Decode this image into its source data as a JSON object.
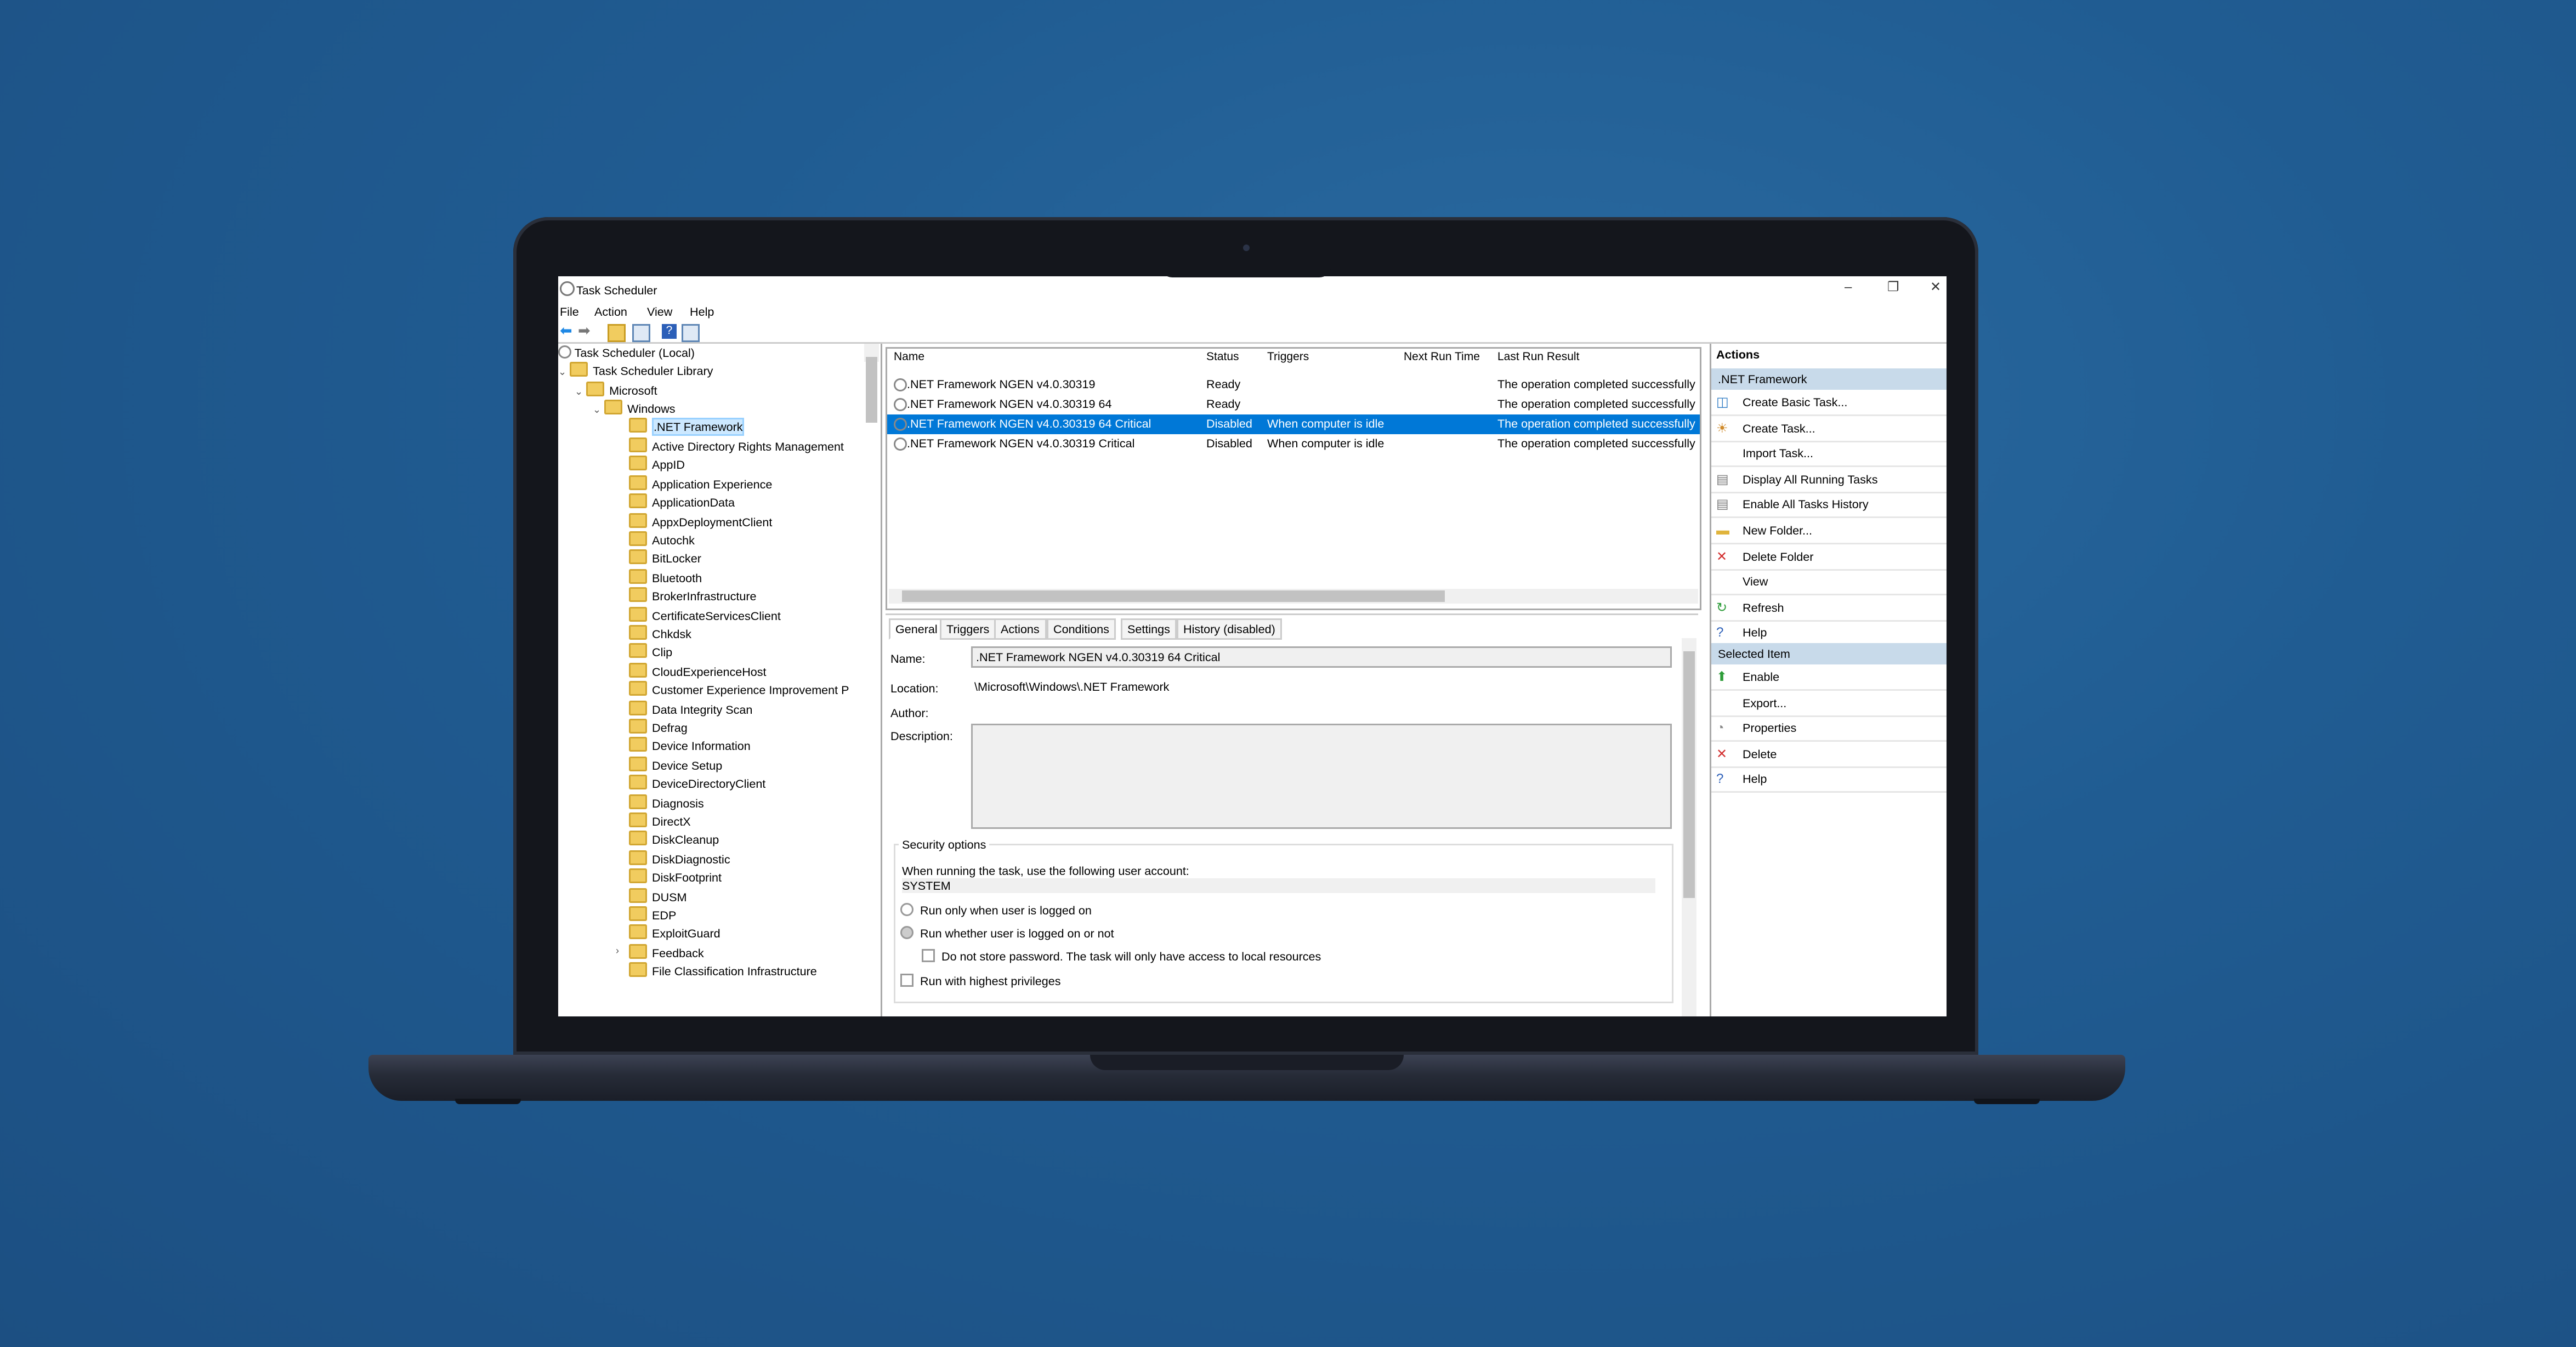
{
  "window": {
    "title": "Task Scheduler",
    "menu": [
      "File",
      "Action",
      "View",
      "Help"
    ]
  },
  "tree": {
    "root": "Task Scheduler (Local)",
    "library": "Task Scheduler Library",
    "microsoft": "Microsoft",
    "windows": "Windows",
    "selected": ".NET Framework",
    "items": [
      "Active Directory Rights Management",
      "AppID",
      "Application Experience",
      "ApplicationData",
      "AppxDeploymentClient",
      "Autochk",
      "BitLocker",
      "Bluetooth",
      "BrokerInfrastructure",
      "CertificateServicesClient",
      "Chkdsk",
      "Clip",
      "CloudExperienceHost",
      "Customer Experience Improvement P",
      "Data Integrity Scan",
      "Defrag",
      "Device Information",
      "Device Setup",
      "DeviceDirectoryClient",
      "Diagnosis",
      "DirectX",
      "DiskCleanup",
      "DiskDiagnostic",
      "DiskFootprint",
      "DUSM",
      "EDP",
      "ExploitGuard",
      "Feedback",
      "File Classification Infrastructure"
    ]
  },
  "tasks": {
    "columns": [
      "Name",
      "Status",
      "Triggers",
      "Next Run Time",
      "Last Run Result"
    ],
    "rows": [
      {
        "name": ".NET Framework NGEN v4.0.30319",
        "status": "Ready",
        "triggers": "",
        "next": "",
        "result": "The operation completed successfully"
      },
      {
        "name": ".NET Framework NGEN v4.0.30319 64",
        "status": "Ready",
        "triggers": "",
        "next": "",
        "result": "The operation completed successfully"
      },
      {
        "name": ".NET Framework NGEN v4.0.30319 64 Critical",
        "status": "Disabled",
        "triggers": "When computer is idle",
        "next": "",
        "result": "The operation completed successfully"
      },
      {
        "name": ".NET Framework NGEN v4.0.30319 Critical",
        "status": "Disabled",
        "triggers": "When computer is idle",
        "next": "",
        "result": "The operation completed successfully"
      }
    ]
  },
  "detail": {
    "tabs": [
      "General",
      "Triggers",
      "Actions",
      "Conditions",
      "Settings",
      "History (disabled)"
    ],
    "name_label": "Name:",
    "name_value": ".NET Framework NGEN v4.0.30319 64 Critical",
    "location_label": "Location:",
    "location_value": "\\Microsoft\\Windows\\.NET Framework",
    "author_label": "Author:",
    "description_label": "Description:",
    "security_title": "Security options",
    "account_prompt": "When running the task, use the following user account:",
    "account_value": "SYSTEM",
    "radio_logged_on": "Run only when user is logged on",
    "radio_whether": "Run whether user is logged on or not",
    "chk_no_password": "Do not store password.  The task will only have access to local resources",
    "chk_highest": "Run with highest privileges"
  },
  "actions": {
    "header": "Actions",
    "section1": ".NET Framework",
    "items1": [
      "Create Basic Task...",
      "Create Task...",
      "Import Task...",
      "Display All Running Tasks",
      "Enable All Tasks History",
      "New Folder...",
      "Delete Folder",
      "View",
      "Refresh",
      "Help"
    ],
    "section2": "Selected Item",
    "items2": [
      "Enable",
      "Export...",
      "Properties",
      "Delete",
      "Help"
    ]
  },
  "colors": {
    "selection": "#0078d7",
    "section_header": "#c8daea",
    "delete_red": "#d32f2f",
    "refresh_green": "#2e9d3a"
  }
}
